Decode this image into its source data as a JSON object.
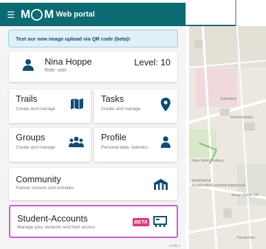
{
  "app": {
    "logo_left": "M",
    "logo_right": "M",
    "portal_label": "Web portal"
  },
  "banner": {
    "text": "Test our new image upload via QR code (beta)!"
  },
  "user": {
    "name": "Nina Hoppe",
    "role": "Role: user",
    "level": "Level: 10"
  },
  "tiles": {
    "trails": {
      "title": "Trails",
      "subtitle": "Create and manage"
    },
    "tasks": {
      "title": "Tasks",
      "subtitle": "Create and manage"
    },
    "groups": {
      "title": "Groups",
      "subtitle": "Create and manage"
    },
    "profile": {
      "title": "Profile",
      "subtitle": "Personal data, statistics"
    },
    "community": {
      "title": "Community",
      "subtitle": "Partner schools and Activities"
    },
    "student_accounts": {
      "title": "Student-Accounts",
      "subtitle": "Manage your students and their access",
      "badge": "BETA"
    }
  },
  "map": {
    "labels": [
      "Gutenberg",
      "Schenckstraße",
      "Mauer-Schiler-Str",
      "Haus Sankt Freiburg",
      "Westfriedhof",
      "Musikinstitut/Gemein­tschaftsschule",
      "Hochschule"
    ]
  },
  "footer": {
    "text": "v3.86.1"
  },
  "colors": {
    "appbar": "#0c6b72",
    "icon": "#0c4e73",
    "highlight_border": "#d84fd8",
    "beta_badge": "#e6357a",
    "banner_bg": "#dff0f6"
  }
}
